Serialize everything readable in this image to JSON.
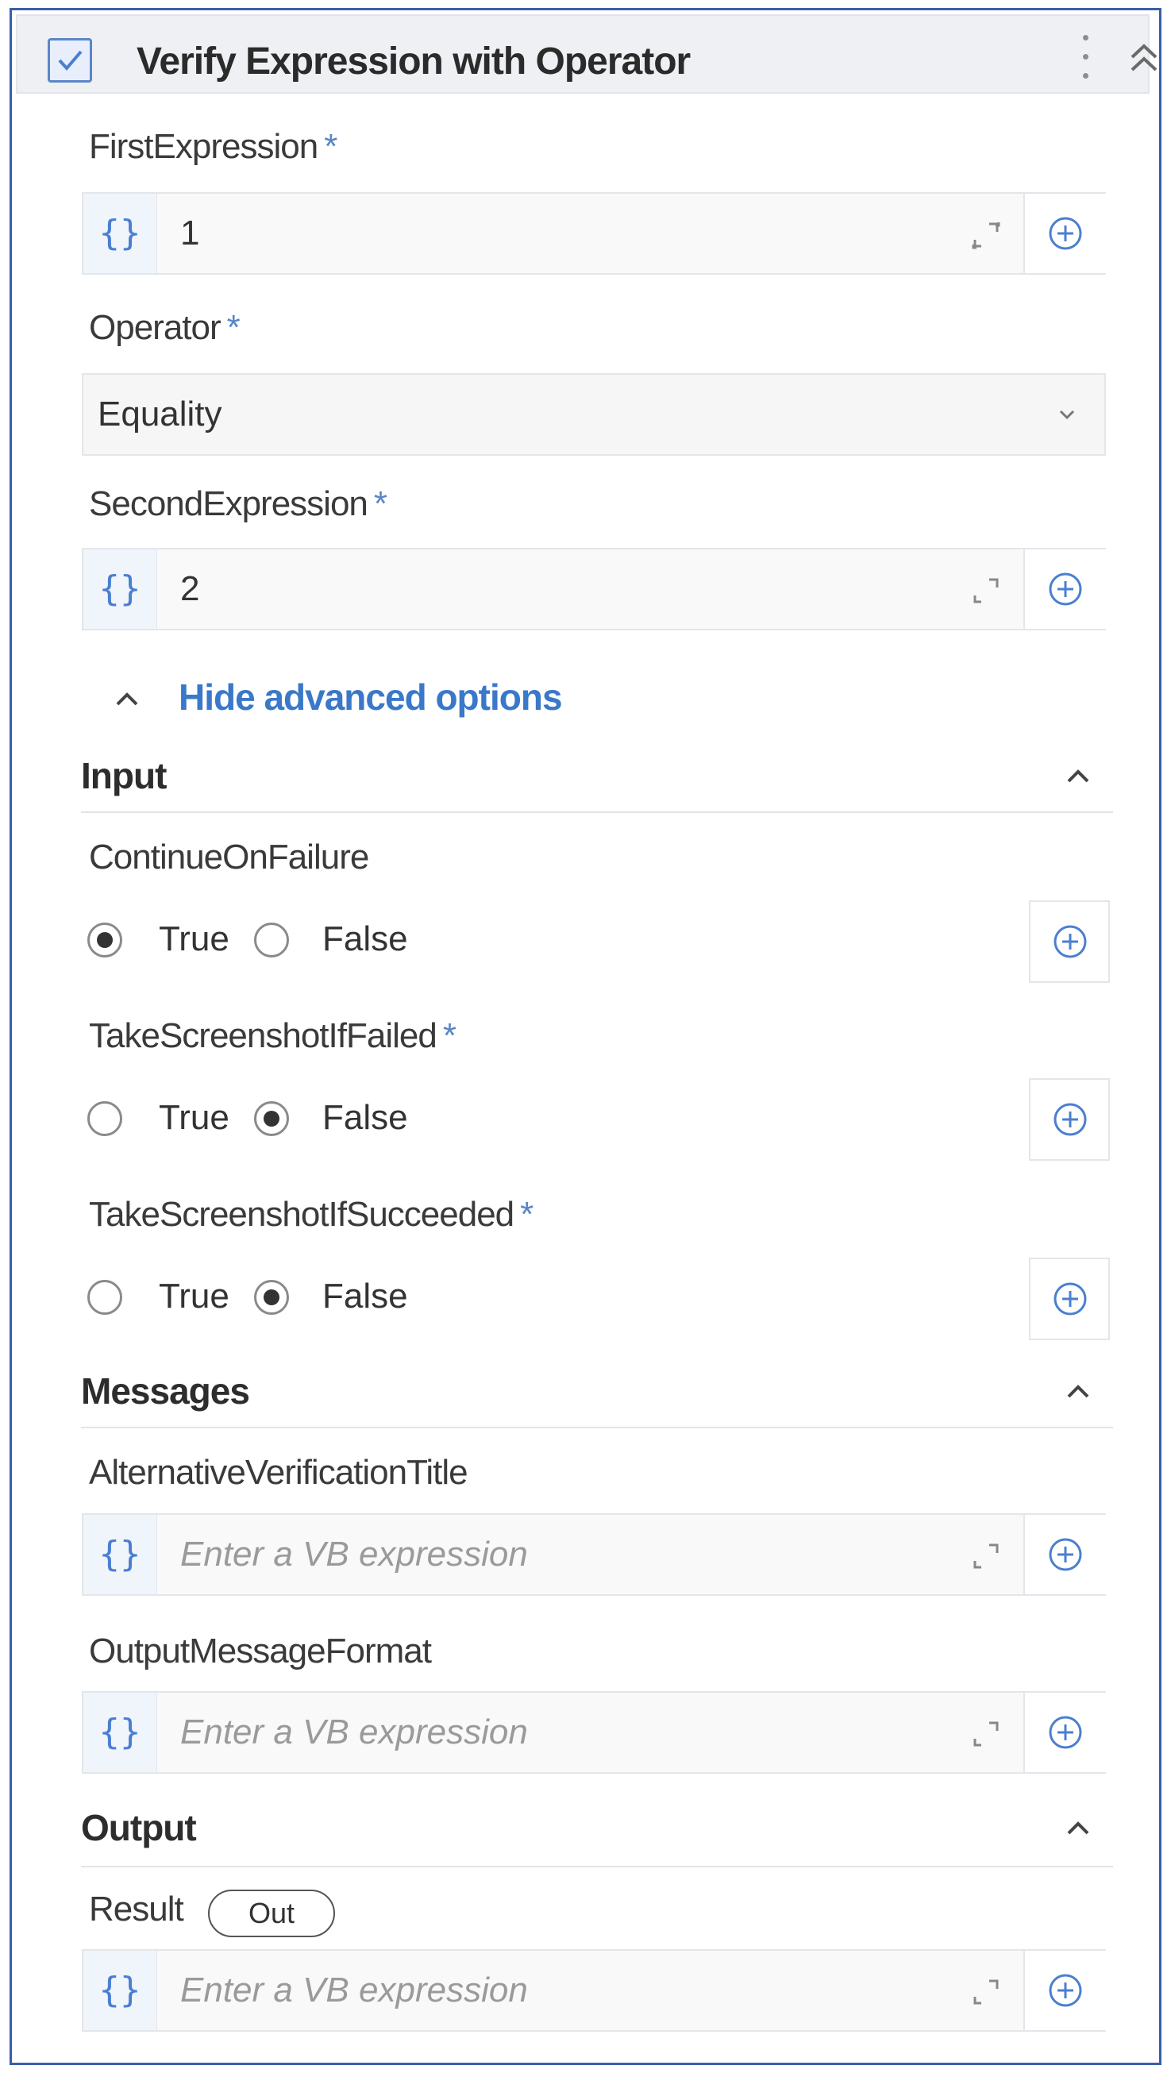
{
  "header": {
    "title": "Verify Expression with Operator"
  },
  "fields": {
    "first_expression": {
      "label": "FirstExpression",
      "value": "1"
    },
    "operator": {
      "label": "Operator",
      "value": "Equality"
    },
    "second_expression": {
      "label": "SecondExpression",
      "value": "2"
    }
  },
  "required_mark": "*",
  "braces": "{}",
  "advanced_toggle": "Hide advanced options",
  "sections": {
    "input": {
      "title": "Input",
      "continue_on_failure": {
        "label": "ContinueOnFailure",
        "true_label": "True",
        "false_label": "False",
        "selected": "True"
      },
      "take_screenshot_if_failed": {
        "label": "TakeScreenshotIfFailed",
        "true_label": "True",
        "false_label": "False",
        "selected": "False"
      },
      "take_screenshot_if_succeeded": {
        "label": "TakeScreenshotIfSucceeded",
        "true_label": "True",
        "false_label": "False",
        "selected": "False"
      }
    },
    "messages": {
      "title": "Messages",
      "alternative_verification_title": {
        "label": "AlternativeVerificationTitle",
        "placeholder": "Enter a VB expression"
      },
      "output_message_format": {
        "label": "OutputMessageFormat",
        "placeholder": "Enter a VB expression"
      }
    },
    "output": {
      "title": "Output",
      "result": {
        "label": "Result",
        "badge": "Out",
        "placeholder": "Enter a VB expression"
      }
    }
  },
  "icons": {
    "checkbox": "checkbox-checked-icon",
    "menu": "kebab-menu-icon",
    "collapse": "double-chevron-up-icon",
    "expand": "expand-editor-icon",
    "plus": "plus-circle-icon",
    "dropdown": "chevron-down-icon"
  },
  "colors": {
    "accent": "#3a78c9",
    "border": "#3a5fa8",
    "header_bg": "#eef0f3"
  }
}
